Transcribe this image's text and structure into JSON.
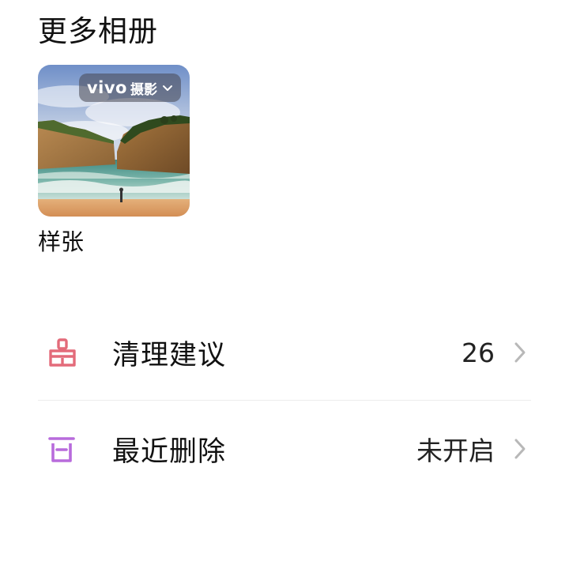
{
  "section": {
    "title": "更多相册"
  },
  "album": {
    "label": "样张",
    "watermark": {
      "brand": "vivo",
      "suffix": "摄影",
      "icon": "chevron-down-icon"
    }
  },
  "menu": [
    {
      "label": "清理建议",
      "value": "26",
      "icon": "broom-icon",
      "icon_color": "#e36b7a"
    },
    {
      "label": "最近删除",
      "value": "未开启",
      "icon": "trash-icon",
      "icon_color": "#b86bdc"
    }
  ],
  "colors": {
    "chevron": "#b8b8b8",
    "divider": "#ececec"
  }
}
